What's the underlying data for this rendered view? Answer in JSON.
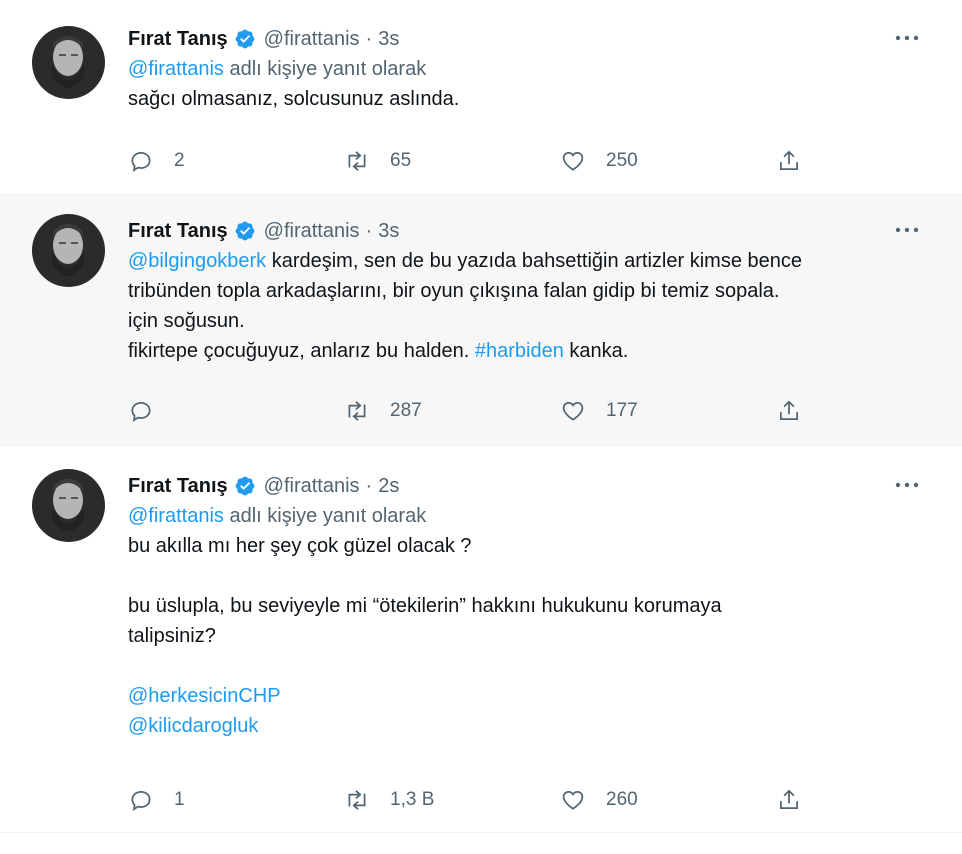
{
  "colors": {
    "link": "#1d9bf0",
    "muted": "#536471",
    "text": "#0f1419",
    "verified": "#1d9bf0"
  },
  "icons": {
    "reply": "reply-icon",
    "retweet": "retweet-icon",
    "like": "heart-icon",
    "share": "share-icon",
    "more": "more-icon",
    "verified": "verified-badge-icon"
  },
  "tweets": [
    {
      "author": {
        "name": "Fırat Tanış",
        "handle": "@firattanis"
      },
      "dot": "·",
      "time": "3s",
      "reply_to": {
        "handle": "@firattanis",
        "suffix": " adlı kişiye yanıt olarak"
      },
      "text_lines": [
        "sağcı olmasanız, solcusunuz aslında."
      ],
      "stats": {
        "replies": "2",
        "retweets": "65",
        "likes": "250"
      }
    },
    {
      "author": {
        "name": "Fırat Tanış",
        "handle": "@firattanis"
      },
      "dot": "·",
      "time": "3s",
      "mention": "@bilgingokberk",
      "line1_rest": " kardeşim, sen de bu yazıda bahsettiğin artizler kimse bence",
      "line2": "tribünden topla arkadaşlarını, bir oyun çıkışına falan gidip bi temiz sopala.",
      "line3": "için soğusun.",
      "line4_start": "fikirtepe çocuğuyuz, anlarız bu halden. ",
      "hashtag": "#harbiden",
      "line4_end": " kanka.",
      "stats": {
        "replies": "",
        "retweets": "287",
        "likes": "177"
      }
    },
    {
      "author": {
        "name": "Fırat Tanış",
        "handle": "@firattanis"
      },
      "dot": "·",
      "time": "2s",
      "reply_to": {
        "handle": "@firattanis",
        "suffix": " adlı kişiye yanıt olarak"
      },
      "line1": "bu akılla mı her şey çok güzel olacak ?",
      "line2": "bu üslupla, bu seviyeyle mi “ötekilerin” hakkını hukukunu korumaya",
      "line3": "talipsiniz?",
      "mentions": [
        "@herkesicinCHP",
        "@kilicdarogluk"
      ],
      "stats": {
        "replies": "1",
        "retweets": "1,3 B",
        "likes": "260"
      }
    }
  ]
}
